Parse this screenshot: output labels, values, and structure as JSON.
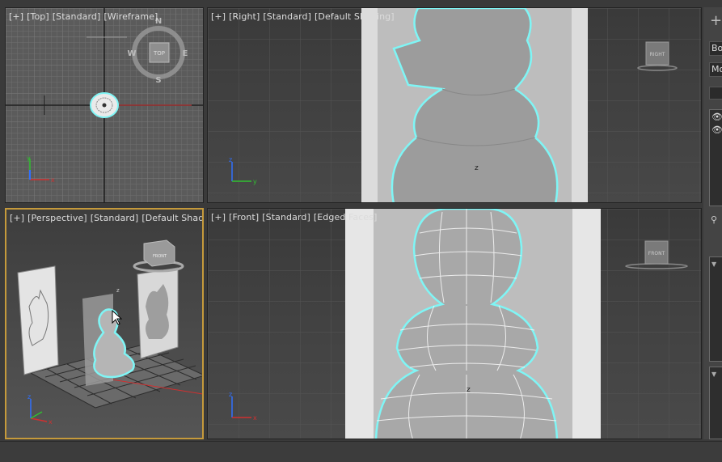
{
  "viewports": {
    "top": {
      "labels": [
        "[+]",
        "[Top]",
        "[Standard]",
        "[Wireframe]"
      ]
    },
    "right": {
      "labels": [
        "[+]",
        "[Right]",
        "[Standard]",
        "[Default Shading]"
      ]
    },
    "perspective": {
      "labels": [
        "[+]",
        "[Perspective]",
        "[Standard]",
        "[Default Shading]"
      ]
    },
    "front": {
      "labels": [
        "[+]",
        "[Front]",
        "[Standard]",
        "[Edged Faces]"
      ]
    }
  },
  "viewcube": {
    "top_face": "TOP",
    "right_face": "RIGHT",
    "front_face": "FRONT",
    "compass": {
      "n": "N",
      "s": "S",
      "e": "E",
      "w": "W"
    }
  },
  "axis_labels": {
    "x": "x",
    "y": "y",
    "z": "z"
  },
  "side_panel": {
    "plus": "+",
    "tab1": "Bo",
    "tab2": "Mo",
    "eye": "👁"
  },
  "colors": {
    "active_border": "#c59a3b",
    "selection": "#7ff5f5",
    "axis_x": "#d03030",
    "axis_y": "#30c030",
    "axis_z": "#3070ff"
  }
}
